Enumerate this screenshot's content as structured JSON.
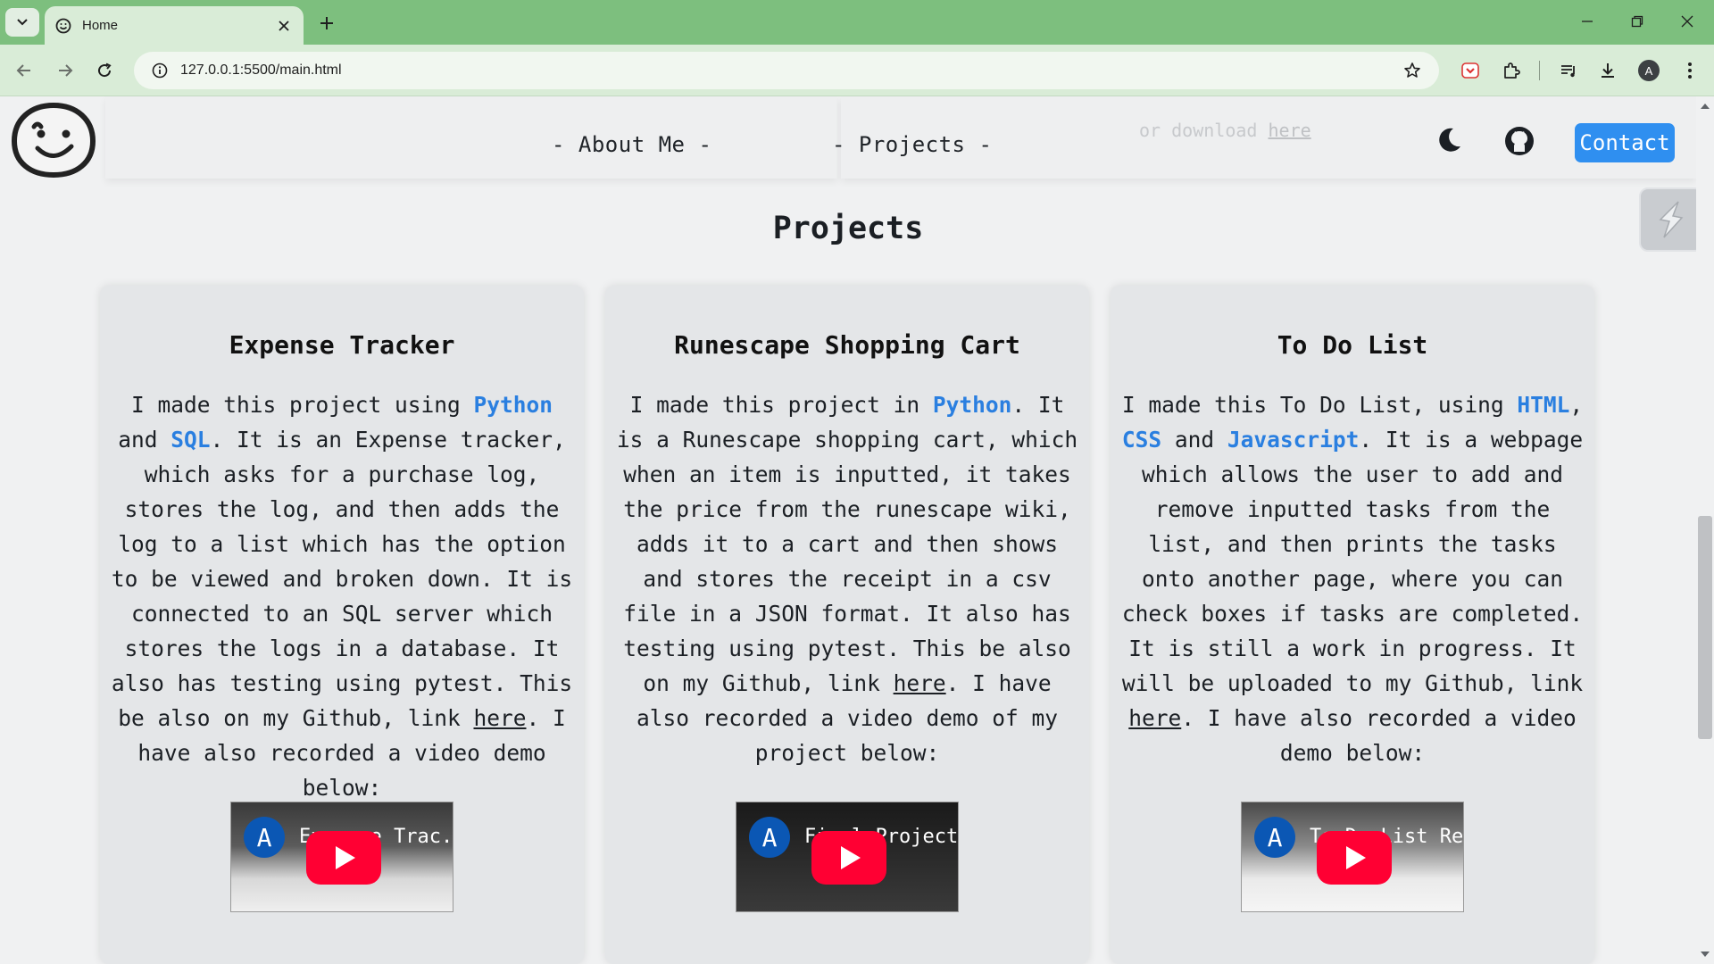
{
  "browser": {
    "tab_title": "Home",
    "url": "127.0.0.1:5500/main.html",
    "profile_initial": "A",
    "accent_color": "#7dbf7e"
  },
  "header": {
    "nav_about": "- About Me -",
    "nav_projects": "- Projects -",
    "download_prefix": "or download ",
    "download_link": "here",
    "contact_label": "Contact"
  },
  "main": {
    "section_title": "Projects",
    "cards": [
      {
        "title": "Expense Tracker",
        "video": {
          "avatar": "A",
          "title": "Expense Trac..."
        }
      },
      {
        "title": "Runescape Shopping Cart",
        "video": {
          "avatar": "A",
          "title": "Final Project ..."
        }
      },
      {
        "title": "To Do List",
        "video": {
          "avatar": "A",
          "title": "To Do List Re..."
        }
      }
    ],
    "card_text": {
      "c1": {
        "p1": "I made this project using ",
        "k1": "Python",
        "p2": " and ",
        "k2": "SQL",
        "p3": ". It is an Expense tracker, which asks for a purchase log, stores the log, and then adds the log to a list which has the option to be viewed and broken down. It is connected to an SQL server which stores the logs in a database. It also has testing using pytest. This be also on my Github, link ",
        "link": "here",
        "p4": ". I have also recorded a video demo below:"
      },
      "c2": {
        "p1": "I made this project in ",
        "k1": "Python",
        "p2": ". It is a Runescape shopping cart, which when an item is inputted, it takes the price from the runescape wiki, adds it to a cart and then shows and stores the receipt in a csv file in a JSON format. It also has testing using pytest. This be also on my Github, link ",
        "link": "here",
        "p3": ". I have also recorded a video demo of my project below:"
      },
      "c3": {
        "p1": "I made this To Do List, using ",
        "k1": "HTML",
        "p2": ", ",
        "k2": "CSS",
        "p3": " and ",
        "k3": "Javascript",
        "p4": ". It is a webpage which allows the user to add and remove inputted tasks from the list, and then prints the tasks onto another page, where you can check boxes if tasks are completed. It is still a work in progress. It will be uploaded to my Github, link ",
        "link": "here",
        "p5": ". I have also recorded a video demo below:"
      }
    },
    "keyword_color": "#2a7fe0",
    "contact_color": "#2f8ff0"
  }
}
